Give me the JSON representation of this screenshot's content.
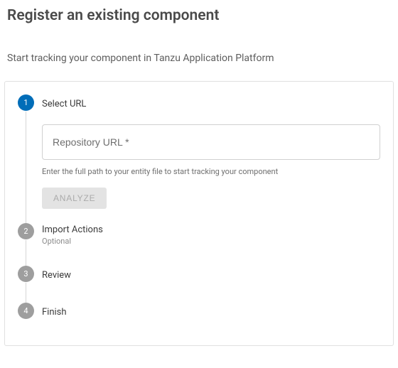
{
  "title": "Register an existing component",
  "subtitle": "Start tracking your component in Tanzu Application Platform",
  "steps": {
    "s1": {
      "num": "1",
      "label": "Select URL",
      "input_placeholder": "Repository URL *",
      "helper": "Enter the full path to your entity file to start tracking your component",
      "button": "ANALYZE"
    },
    "s2": {
      "num": "2",
      "label": "Import Actions",
      "sublabel": "Optional"
    },
    "s3": {
      "num": "3",
      "label": "Review"
    },
    "s4": {
      "num": "4",
      "label": "Finish"
    }
  }
}
